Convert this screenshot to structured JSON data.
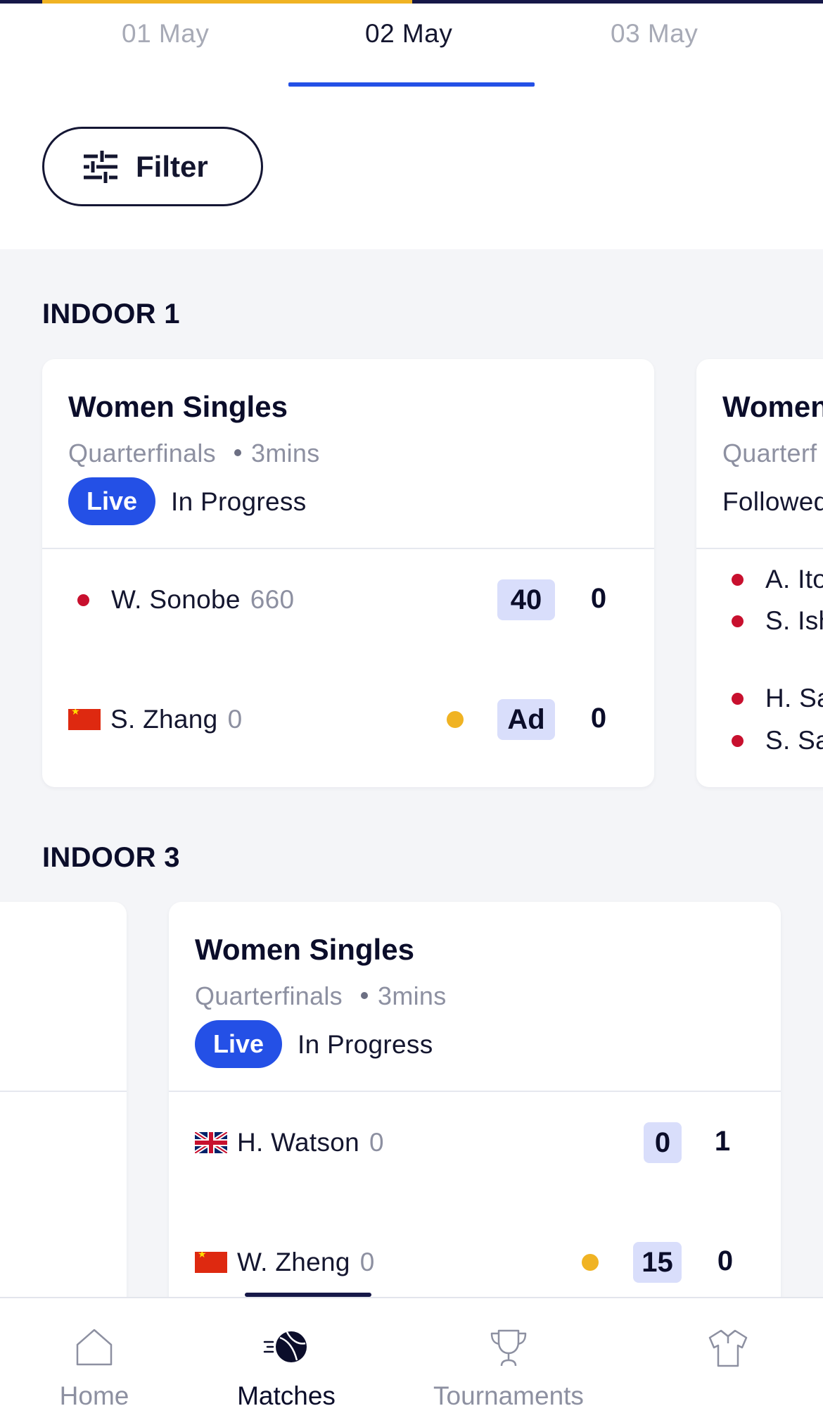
{
  "date_tabs": [
    {
      "label": "01 May",
      "active": false
    },
    {
      "label": "02 May",
      "active": true
    },
    {
      "label": "03 May",
      "active": false
    }
  ],
  "filter": {
    "label": "Filter",
    "icon": "sliders-icon"
  },
  "courts": [
    {
      "title": "INDOOR 1",
      "cards": [
        {
          "event": "Women Singles",
          "round": "Quarterfinals",
          "duration": "3mins",
          "live_label": "Live",
          "status": "In Progress",
          "players": [
            {
              "name": "W. Sonobe",
              "seed": "660",
              "flag": "japan-dot",
              "serving": false,
              "points": "40",
              "games": "0"
            },
            {
              "name": "S. Zhang",
              "seed": "0",
              "flag": "china-flag",
              "serving": true,
              "points": "Ad",
              "games": "0"
            }
          ]
        },
        {
          "event": "Women",
          "round": "Quarterf",
          "status": "Followed",
          "players": [
            "A. Ito",
            "S. Ish",
            "H. Sa",
            "S. Sa"
          ]
        }
      ]
    },
    {
      "title": "INDOOR 3",
      "cards": [
        {
          "event": "Women Singles",
          "round": "Quarterfinals",
          "duration": "3mins",
          "live_label": "Live",
          "status": "In Progress",
          "players": [
            {
              "name": "H. Watson",
              "seed": "0",
              "flag": "uk-flag",
              "serving": false,
              "points": "0",
              "games": "1"
            },
            {
              "name": "W. Zheng",
              "seed": "0",
              "flag": "china-flag",
              "serving": true,
              "points": "15",
              "games": "0"
            }
          ]
        }
      ]
    }
  ],
  "bottom_nav": [
    {
      "label": "Home",
      "icon": "home-icon",
      "active": false
    },
    {
      "label": "Matches",
      "icon": "tennis-ball-icon",
      "active": true
    },
    {
      "label": "Tournaments",
      "icon": "trophy-icon",
      "active": false
    },
    {
      "label": "",
      "icon": "shirt-icon",
      "active": false
    }
  ],
  "colors": {
    "accent_blue": "#2450e6",
    "navy": "#161848",
    "serve_yellow": "#f0b323",
    "point_box": "#d9defb"
  }
}
